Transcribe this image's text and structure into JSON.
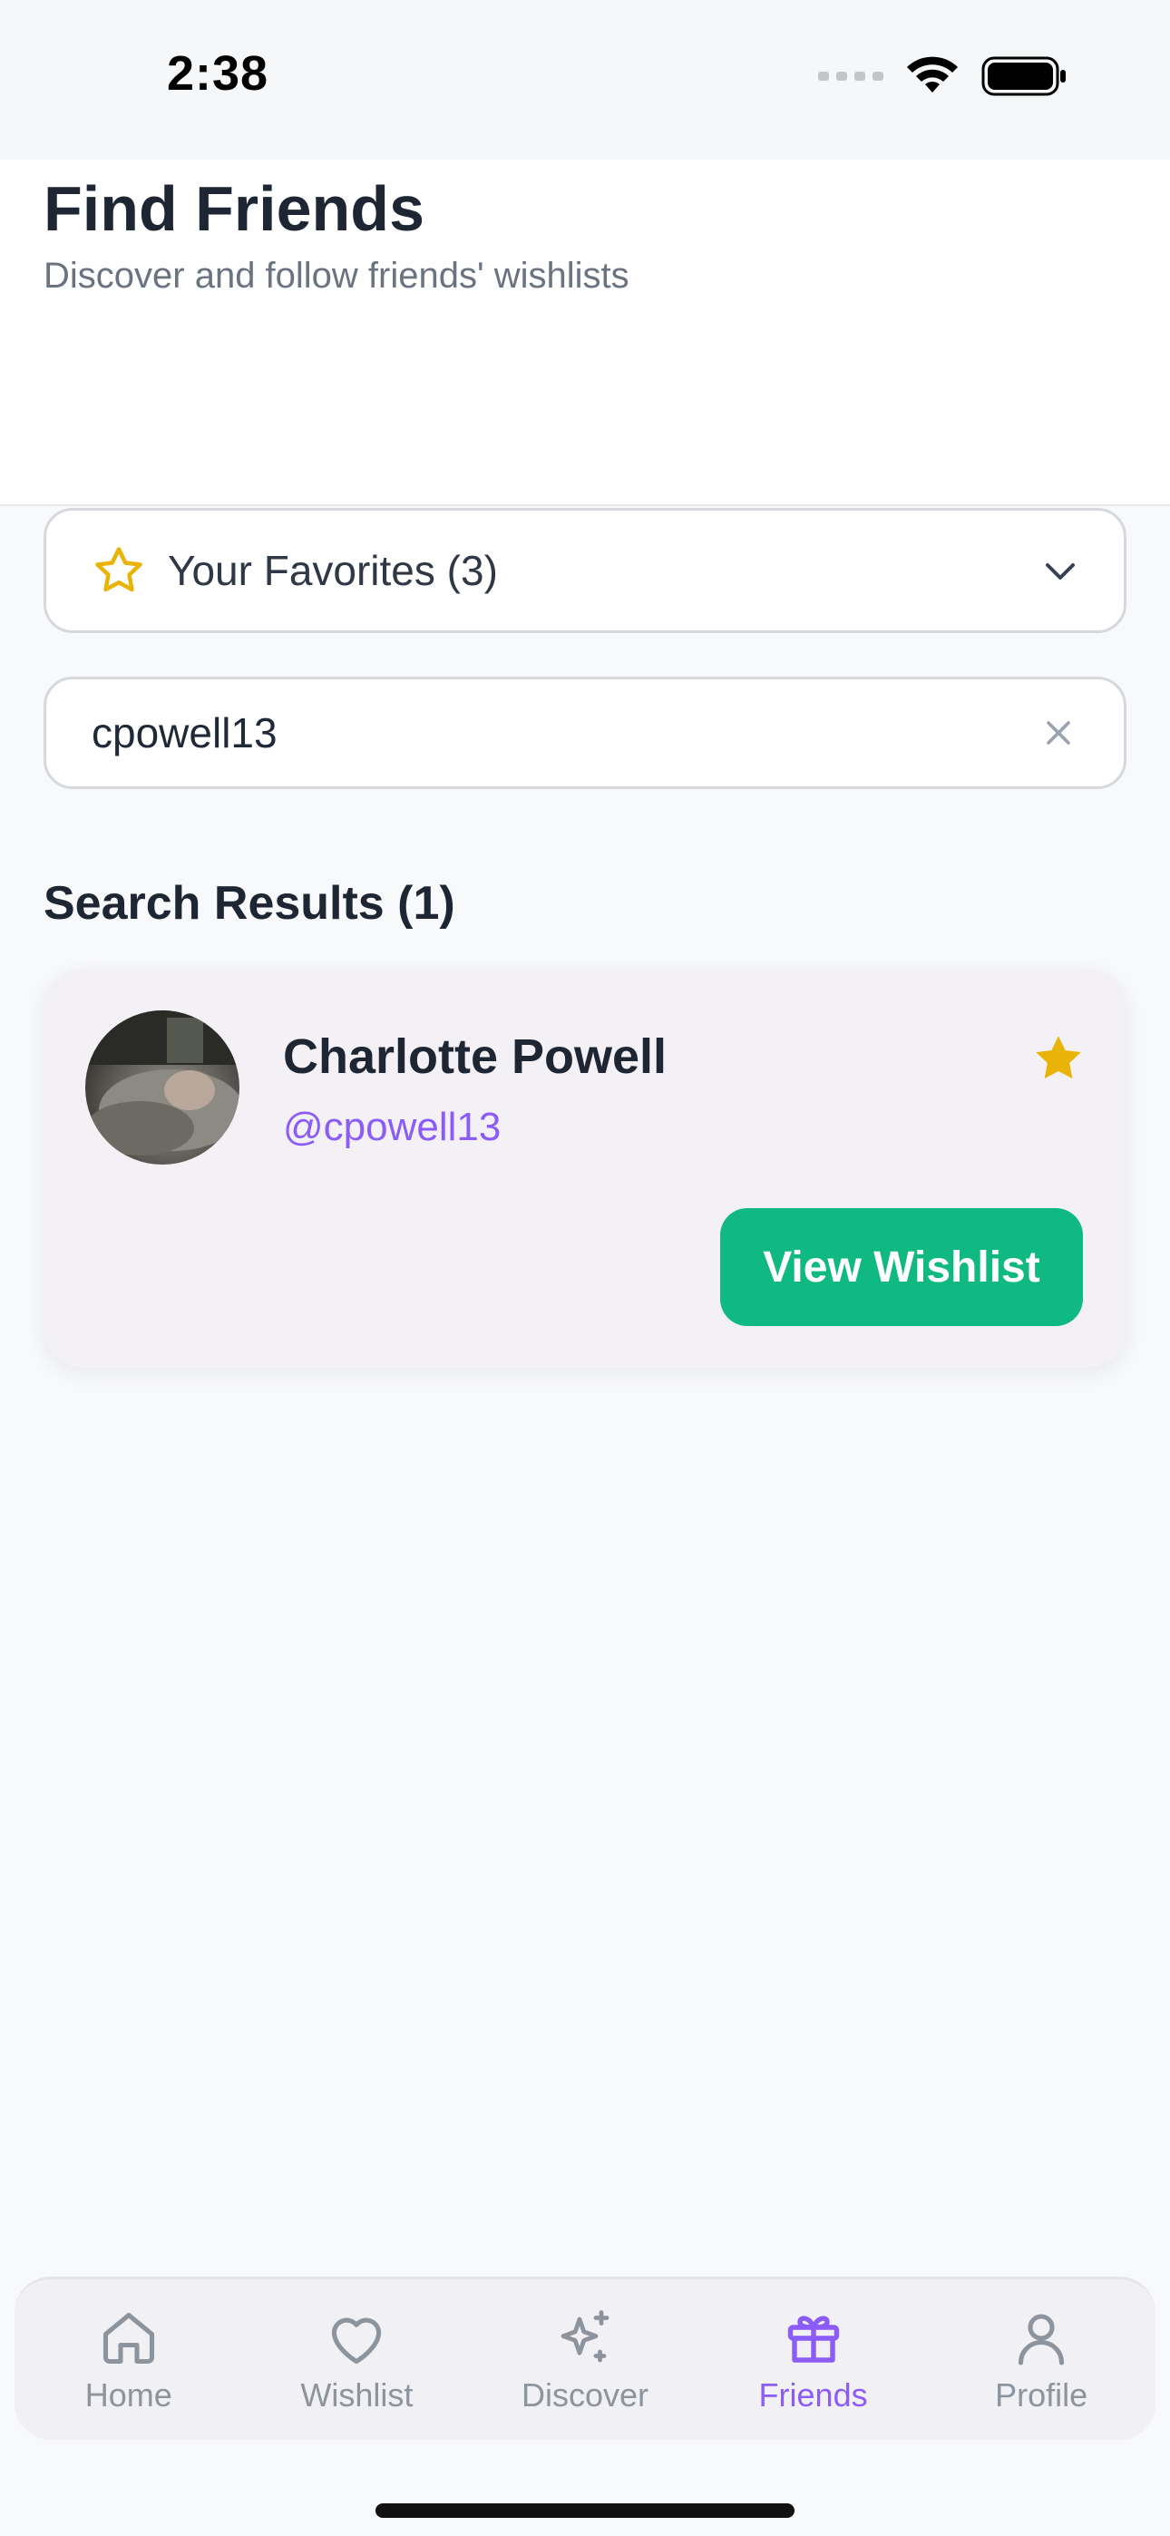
{
  "status_bar": {
    "time": "2:38"
  },
  "header": {
    "title": "Find Friends",
    "subtitle": "Discover and follow friends' wishlists"
  },
  "favorites": {
    "label": "Your Favorites (3)"
  },
  "search": {
    "value": "cpowell13",
    "placeholder": ""
  },
  "results": {
    "title": "Search Results (1)",
    "items": [
      {
        "name": "Charlotte Powell",
        "handle": "@cpowell13",
        "favorited": true,
        "button_label": "View Wishlist"
      }
    ]
  },
  "tabs": [
    {
      "label": "Home",
      "icon": "home-icon",
      "active": false
    },
    {
      "label": "Wishlist",
      "icon": "heart-icon",
      "active": false
    },
    {
      "label": "Discover",
      "icon": "sparkles-icon",
      "active": false
    },
    {
      "label": "Friends",
      "icon": "gift-icon",
      "active": true
    },
    {
      "label": "Profile",
      "icon": "user-icon",
      "active": false
    }
  ],
  "colors": {
    "accent": "#8b5cf6",
    "button": "#10b981",
    "star": "#eab308",
    "inactive_tab": "#8e949e"
  }
}
